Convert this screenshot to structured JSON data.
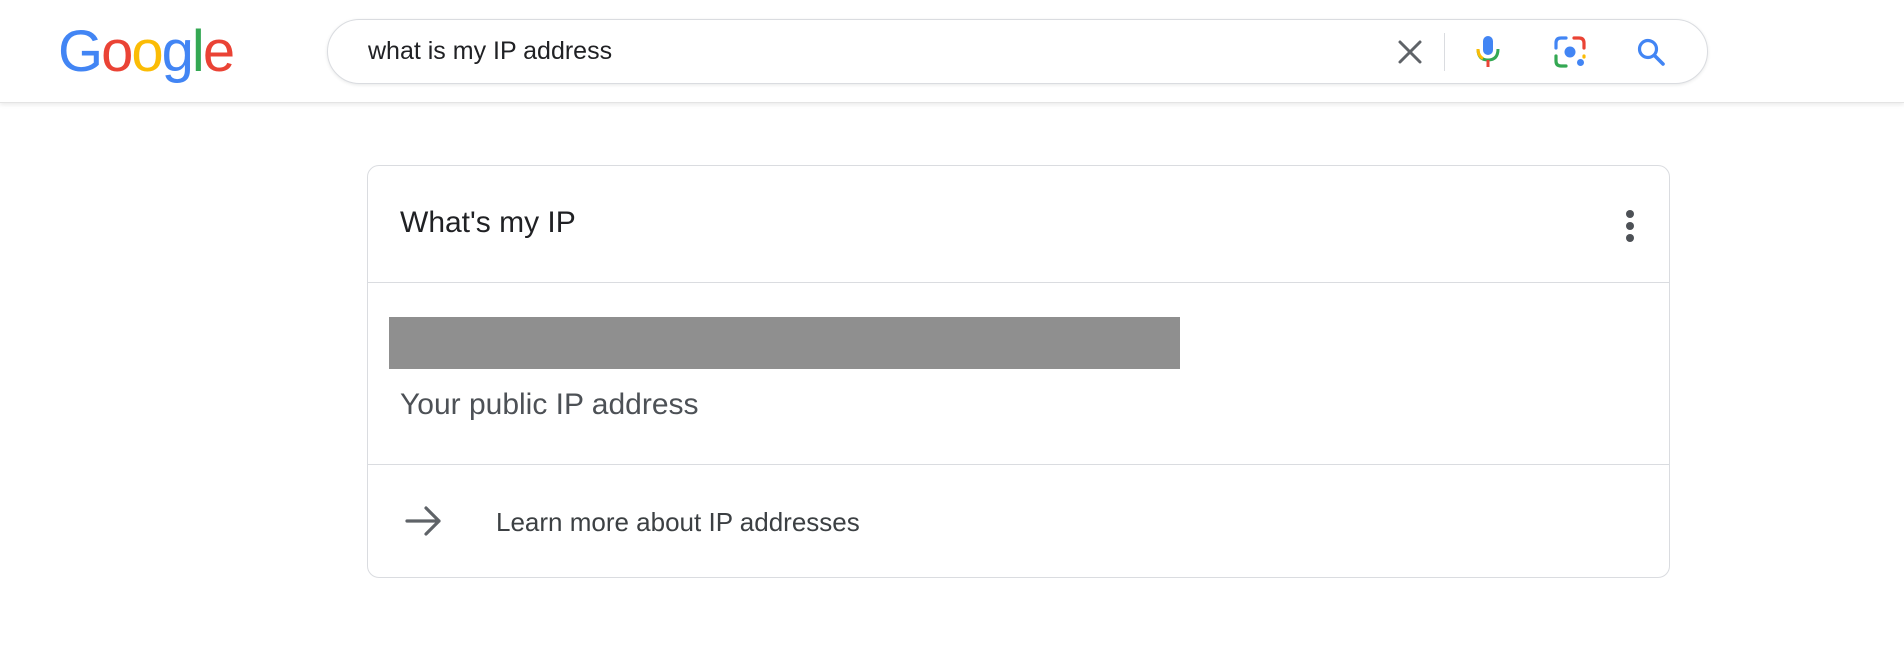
{
  "header": {
    "logo_letters": [
      "G",
      "o",
      "o",
      "g",
      "l",
      "e"
    ],
    "logo_colors": [
      "#4285F4",
      "#EA4335",
      "#FBBC05",
      "#4285F4",
      "#34A853",
      "#EA4335"
    ],
    "search": {
      "value": "what is my IP address"
    },
    "icons": {
      "clear": "close-icon",
      "voice": "microphone-icon",
      "lens": "camera-lens-icon",
      "search": "search-icon"
    }
  },
  "card": {
    "title": "What's my IP",
    "ip_caption": "Your public IP address",
    "learn_more_label": "Learn more about IP addresses"
  },
  "colors": {
    "blue": "#4285F4",
    "red": "#EA4335",
    "yellow": "#FBBC05",
    "green": "#34A853",
    "redacted": "#8f8f8f"
  }
}
